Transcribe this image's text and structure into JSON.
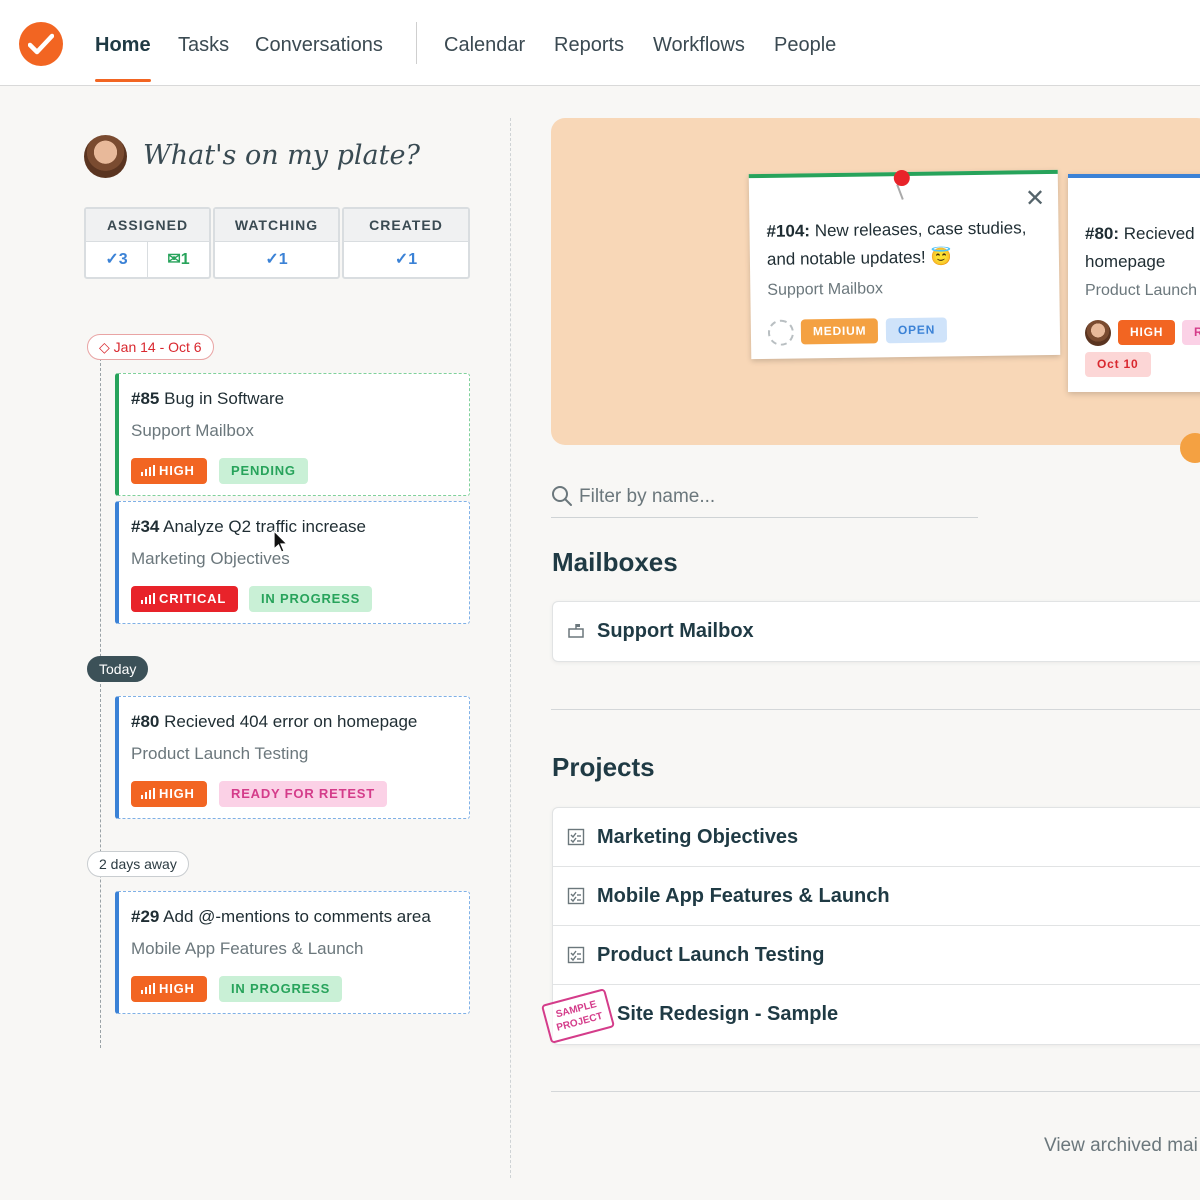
{
  "nav": {
    "items": [
      {
        "label": "Home",
        "active": true
      },
      {
        "label": "Tasks"
      },
      {
        "label": "Conversations"
      },
      {
        "label": "Calendar"
      },
      {
        "label": "Reports"
      },
      {
        "label": "Workflows"
      },
      {
        "label": "People"
      }
    ]
  },
  "plate": {
    "title": "What's on my plate?",
    "counters": {
      "assigned": {
        "label": "ASSIGNED",
        "tasks": "3",
        "mail": "1"
      },
      "watching": {
        "label": "WATCHING",
        "tasks": "1"
      },
      "created": {
        "label": "CREATED",
        "tasks": "1"
      }
    }
  },
  "timeline": {
    "range_label": "Jan 14 - Oct 6",
    "today_label": "Today",
    "away_label": "2 days away",
    "tasks": [
      {
        "id": "#85",
        "title": "Bug in Software",
        "project": "Support Mailbox",
        "priority": "HIGH",
        "status": "PENDING"
      },
      {
        "id": "#34",
        "title": "Analyze Q2 traffic increase",
        "project": "Marketing Objectives",
        "priority": "CRITICAL",
        "status": "IN PROGRESS"
      },
      {
        "id": "#80",
        "title": "Recieved 404 error on homepage",
        "project": "Product Launch Testing",
        "priority": "HIGH",
        "status": "READY FOR RETEST"
      },
      {
        "id": "#29",
        "title": "Add @-mentions to comments area",
        "project": "Mobile App Features & Launch",
        "priority": "HIGH",
        "status": "IN PROGRESS"
      }
    ]
  },
  "corkboard": {
    "notes": [
      {
        "id": "#104:",
        "title_line1": "New releases, case studies,",
        "title_line2": "and notable updates! 😇",
        "sub": "Support Mailbox",
        "badge1": "MEDIUM",
        "badge2": "OPEN"
      },
      {
        "id": "#80:",
        "title_line1": "Recieved",
        "title_line2": "homepage",
        "sub": "Product Launch",
        "badge1": "HIGH",
        "badge3": "R",
        "date": "Oct 10"
      }
    ]
  },
  "filter": {
    "placeholder": "Filter by name..."
  },
  "mailboxes": {
    "title": "Mailboxes",
    "items": [
      {
        "label": "Support Mailbox"
      }
    ]
  },
  "projects": {
    "title": "Projects",
    "items": [
      {
        "label": "Marketing Objectives"
      },
      {
        "label": "Mobile App Features & Launch"
      },
      {
        "label": "Product Launch Testing"
      },
      {
        "label": "Site Redesign - Sample",
        "stamp": "SAMPLE PROJECT"
      }
    ]
  },
  "archived_link": "View archived mai",
  "colors": {
    "brand": "#f26522",
    "green": "#27a35b",
    "blue": "#3b82d6",
    "critical": "#e8232a"
  }
}
